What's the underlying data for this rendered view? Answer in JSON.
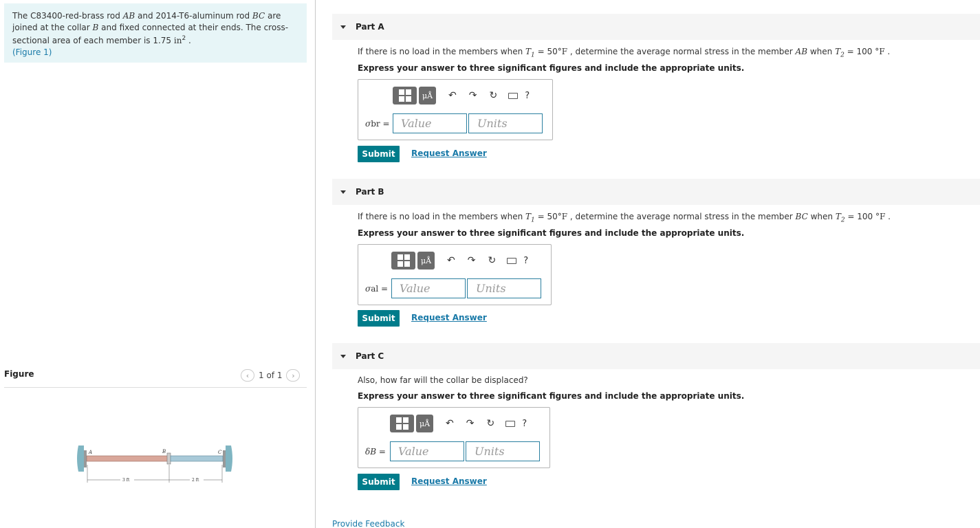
{
  "problem": {
    "text_1": "The C83400-red-brass rod ",
    "ab": "AB",
    "text_2": " and 2014-T6-aluminum rod ",
    "bc": "BC",
    "text_3": " are joined at the collar ",
    "b": "B",
    "text_4": " and fixed connected at their ends. The cross-sectional area of each member is 1.75 ",
    "unit": "in",
    "unit_exp": "2",
    "text_5": " .",
    "figure_link": "(Figure 1)"
  },
  "figure": {
    "label": "Figure",
    "pager": "1 of 1",
    "prev_icon": "chevron-left-icon",
    "next_icon": "chevron-right-icon",
    "point_a": "A",
    "point_b": "B",
    "point_c": "C",
    "dim_ab": "3 ft",
    "dim_bc": "2 ft"
  },
  "parts": [
    {
      "title": "Part A",
      "q_1": "If there is no load in the members when ",
      "t1": "T",
      "t1_sub": "1",
      "q_2": " = 50",
      "deg": "°F",
      "q_3": " , determine the average normal stress in the member ",
      "member": "AB",
      "q_4": "  when ",
      "t2": "T",
      "t2_sub": "2",
      "q_5": " = 100 ",
      "deg2": "°F",
      "q_6": " .",
      "instruction": "Express your answer to three significant figures and include the appropriate units.",
      "label_sym": "σ",
      "label_sub": "br",
      "value_placeholder": "Value",
      "units_placeholder": "Units",
      "submit": "Submit",
      "request": "Request Answer"
    },
    {
      "title": "Part B",
      "q_1": "If there is no load in the members when ",
      "t1": "T",
      "t1_sub": "1",
      "q_2": " = 50",
      "deg": "°F",
      "q_3": " , determine the average normal stress in the member ",
      "member": "BC",
      "q_4": "  when ",
      "t2": "T",
      "t2_sub": "2",
      "q_5": " = 100 ",
      "deg2": "°F",
      "q_6": " .",
      "instruction": "Express your answer to three significant figures and include the appropriate units.",
      "label_sym": "σ",
      "label_sub": "al",
      "value_placeholder": "Value",
      "units_placeholder": "Units",
      "submit": "Submit",
      "request": "Request Answer"
    },
    {
      "title": "Part C",
      "question": "Also, how far will the collar be displaced?",
      "instruction": "Express your answer to three significant figures and include the appropriate units.",
      "label_sym": "δ",
      "label_sub": "B",
      "value_placeholder": "Value",
      "units_placeholder": "Units",
      "submit": "Submit",
      "request": "Request Answer"
    }
  ],
  "toolbar": {
    "units_btn": "μÅ",
    "undo_icon": "undo-icon",
    "redo_icon": "redo-icon",
    "reset_icon": "reset-icon",
    "keyboard_icon": "keyboard-icon",
    "help": "?"
  },
  "feedback": "Provide Feedback"
}
